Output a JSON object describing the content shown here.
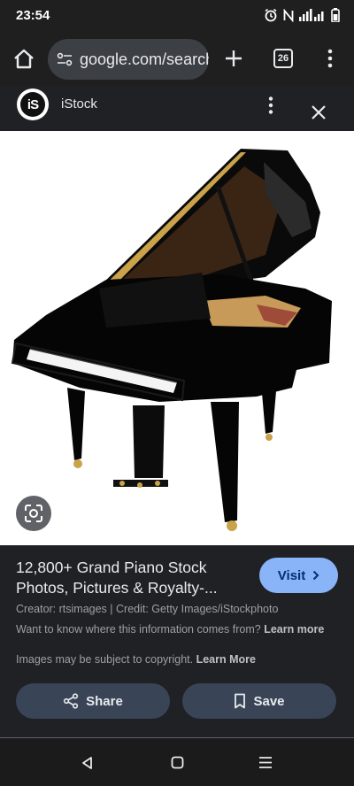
{
  "status_bar": {
    "time": "23:54"
  },
  "browser": {
    "url": "google.com/search",
    "tab_count": "26"
  },
  "result": {
    "site_logo_text": "iS",
    "site_name": "iStock",
    "title": "12,800+ Grand Piano Stock Photos, Pictures & Royalty-...",
    "visit_label": "Visit",
    "credit": "Creator: rtsimages | Credit: Getty Images/iStockphoto",
    "info_text": "Want to know where this information comes from?",
    "info_link": "Learn more",
    "copyright_text": "Images may be subject to copyright.",
    "copyright_link": "Learn More",
    "share_label": "Share",
    "save_label": "Save"
  },
  "icons": {
    "home": "home-icon",
    "tune": "tune-icon",
    "plus": "plus-icon",
    "more": "more-vert-icon",
    "close": "close-icon",
    "lens": "lens-icon",
    "share": "share-icon",
    "bookmark": "bookmark-icon"
  },
  "colors": {
    "accent": "#8ab4f8",
    "button_bg": "#394457",
    "background": "#202124"
  }
}
